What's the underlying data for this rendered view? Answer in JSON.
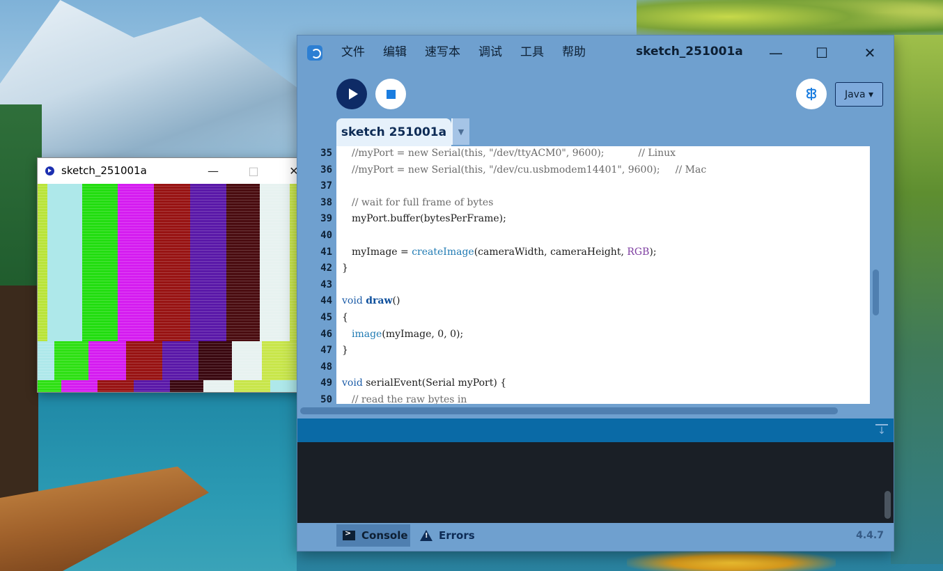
{
  "sketch_window": {
    "title": "sketch_251001a",
    "minimize": "—",
    "maximize": "□",
    "close": "✕"
  },
  "main_window": {
    "title": "sketch_251001a",
    "menu": [
      "文件",
      "编辑",
      "速写本",
      "调试",
      "工具",
      "帮助"
    ],
    "controls": {
      "minimize": "—",
      "maximize": "☐",
      "close": "✕"
    }
  },
  "toolbar": {
    "debug_icon": "butterfly-icon",
    "mode_label": "Java ▾"
  },
  "tabs": {
    "active_label": "sketch 251001a",
    "menu_arrow": "▼"
  },
  "editor": {
    "line_numbers": [
      "35",
      "36",
      "37",
      "38",
      "39",
      "40",
      "41",
      "42",
      "43",
      "44",
      "45",
      "46",
      "47",
      "48",
      "49",
      "50"
    ],
    "lines": [
      [
        {
          "t": "//myPort = new Serial(this, \"/dev/ttyACM0\", 9600);           // Linux",
          "c": "cm"
        }
      ],
      [
        {
          "t": "//myPort = new Serial(this, \"/dev/cu.usbmodem14401\", 9600);     // Mac",
          "c": "cm"
        }
      ],
      [],
      [
        {
          "t": "// wait for full frame of bytes",
          "c": "cm"
        }
      ],
      [
        {
          "t": "myPort.buffer(bytesPerFrame);",
          "c": ""
        }
      ],
      [],
      [
        {
          "t": "myImage = ",
          "c": ""
        },
        {
          "t": "createImage",
          "c": "bf"
        },
        {
          "t": "(cameraWidth, cameraHeight, ",
          "c": ""
        },
        {
          "t": "RGB",
          "c": "cn"
        },
        {
          "t": ");",
          "c": ""
        }
      ],
      [
        {
          "t": "}",
          "c": ""
        }
      ],
      [],
      [
        {
          "t": "void ",
          "c": "kw"
        },
        {
          "t": "draw",
          "c": "fn"
        },
        {
          "t": "()",
          "c": ""
        }
      ],
      [
        {
          "t": "{",
          "c": ""
        }
      ],
      [
        {
          "t": "image",
          "c": "bf"
        },
        {
          "t": "(myImage, 0, 0);",
          "c": ""
        }
      ],
      [
        {
          "t": "}",
          "c": ""
        }
      ],
      [],
      [
        {
          "t": "void ",
          "c": "kw"
        },
        {
          "t": "serialEvent(Serial myPort) {",
          "c": ""
        }
      ],
      [
        {
          "t": "// read the raw bytes in",
          "c": "cm"
        }
      ]
    ],
    "indent": [
      1,
      1,
      0,
      1,
      1,
      0,
      1,
      0,
      0,
      0,
      0,
      1,
      0,
      0,
      0,
      1
    ]
  },
  "console": {
    "collapse_icon": "collapse-console-icon",
    "tab_console": "Console",
    "tab_errors": "Errors",
    "version": "4.4.7"
  },
  "colors": {
    "window_blue": "#6fa0cf",
    "run_button": "#0e2b66",
    "console_bg": "#1a1f26",
    "console_header": "#0a6aa6"
  }
}
